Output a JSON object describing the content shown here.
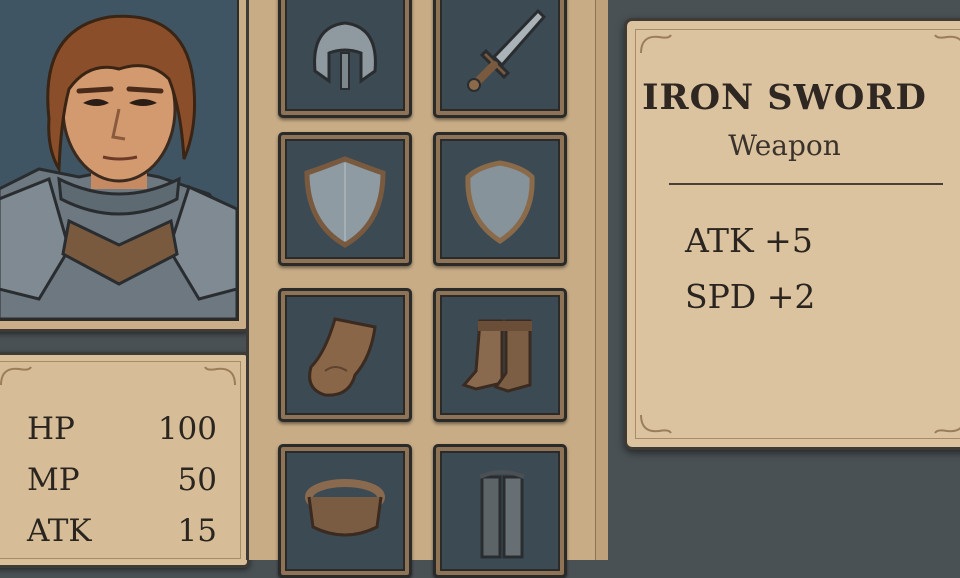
{
  "character": {
    "portrait": "character-portrait"
  },
  "stats": [
    {
      "label": "HP",
      "value": "100"
    },
    {
      "label": "MP",
      "value": "50"
    },
    {
      "label": "ATK",
      "value": "15"
    }
  ],
  "inventory": [
    {
      "icon": "helmet-icon"
    },
    {
      "icon": "sword-icon"
    },
    {
      "icon": "kite-shield-icon"
    },
    {
      "icon": "round-shield-icon"
    },
    {
      "icon": "gloves-icon"
    },
    {
      "icon": "boots-icon"
    },
    {
      "icon": "belt-icon"
    },
    {
      "icon": "greaves-icon"
    }
  ],
  "selected_item": {
    "name": "IRON SWORD",
    "type": "Weapon",
    "bonuses": [
      "ATK +5",
      "SPD +2"
    ]
  },
  "colors": {
    "parchment": "#dcc39f",
    "frame": "#3e3a35",
    "slot_bg": "#3c4a53",
    "background": "#4a5155"
  }
}
